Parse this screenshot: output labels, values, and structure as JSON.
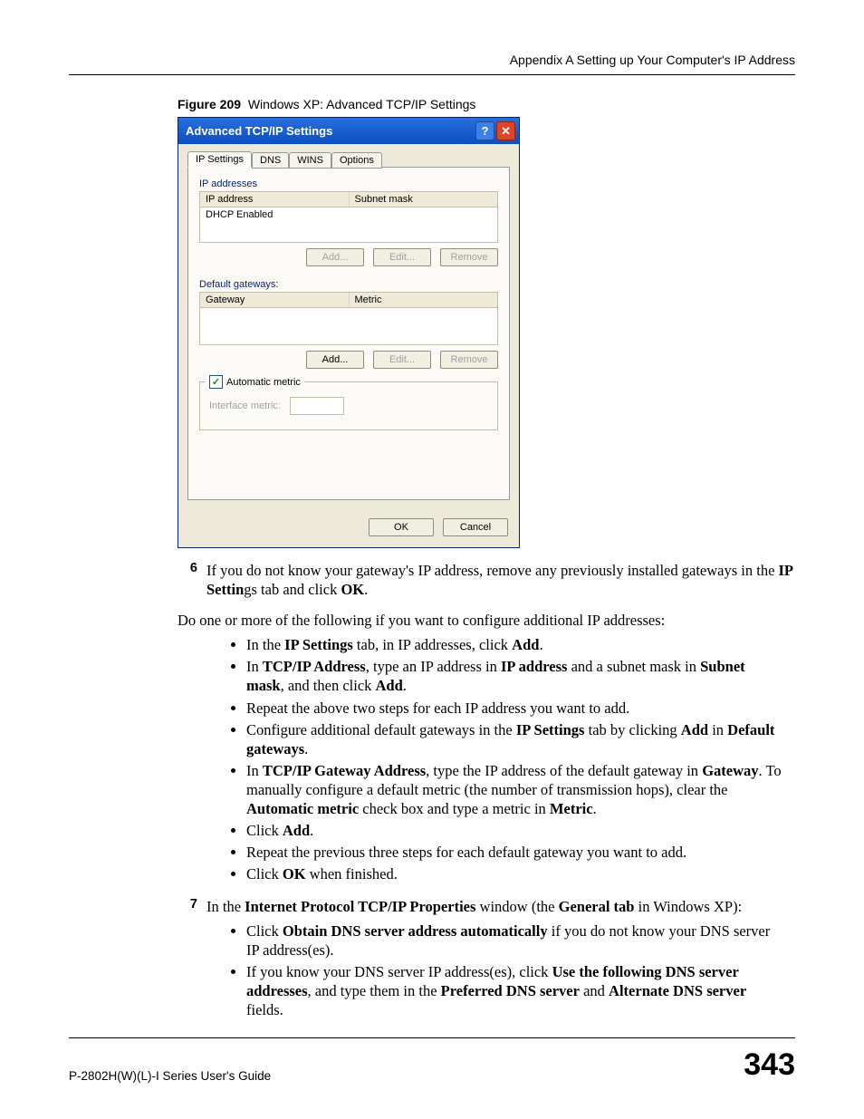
{
  "header": {
    "section": "Appendix A Setting up Your Computer's IP Address"
  },
  "caption": {
    "label": "Figure 209",
    "text": "Windows XP: Advanced TCP/IP Settings"
  },
  "dialog": {
    "title": "Advanced TCP/IP Settings",
    "help_glyph": "?",
    "close_glyph": "✕",
    "tabs": {
      "ip": "IP Settings",
      "dns": "DNS",
      "wins": "WINS",
      "options": "Options"
    },
    "ipaddr": {
      "legend": "IP addresses",
      "col1": "IP address",
      "col2": "Subnet mask",
      "status": "DHCP Enabled"
    },
    "gw": {
      "legend": "Default gateways:",
      "col1": "Gateway",
      "col2": "Metric"
    },
    "metric": {
      "check_label": "Automatic metric",
      "field_label": "Interface metric:"
    },
    "buttons": {
      "add": "Add...",
      "edit": "Edit...",
      "remove": "Remove",
      "ok": "OK",
      "cancel": "Cancel"
    }
  },
  "step6": {
    "num": "6",
    "text_a": "If you do not know your gateway's IP address, remove any previously installed gateways in the ",
    "bold_a": "IP Settin",
    "text_b": "gs tab and click ",
    "bold_b": "OK",
    "text_c": "."
  },
  "para": "Do one or more of the following if you want to configure additional IP addresses:",
  "bullets": {
    "b1": {
      "a": "In the ",
      "b1": "IP Settings",
      "b": " tab, in IP addresses, click ",
      "b2": "Add",
      "c": "."
    },
    "b2": {
      "a": "In ",
      "b1": "TCP/IP Address",
      "b": ", type an IP address in ",
      "b2": "IP address",
      "c": " and a subnet mask in ",
      "b3": "Subnet mask",
      "d": ", and then click ",
      "b4": "Add",
      "e": "."
    },
    "b3": {
      "a": "Repeat the above two steps for each IP address you want to add."
    },
    "b4": {
      "a": "Configure additional default gateways in the ",
      "b1": "IP Settings",
      "b": " tab by clicking ",
      "b2": "Add",
      "c": " in ",
      "b3": "Default gateways",
      "d": "."
    },
    "b5": {
      "a": "In ",
      "b1": "TCP/IP Gateway Address",
      "b": ", type the IP address of the default gateway in ",
      "b2": "Gateway",
      "c": ". To manually configure a default metric (the number of transmission hops), clear the ",
      "b3": "Automatic metric",
      "d": " check box and type a metric in ",
      "b4": "Metric",
      "e": "."
    },
    "b6": {
      "a": "Click ",
      "b1": "Add",
      "b": "."
    },
    "b7": {
      "a": "Repeat the previous three steps for each default gateway you want to add."
    },
    "b8": {
      "a": "Click ",
      "b1": "OK",
      "b": " when finished."
    }
  },
  "step7": {
    "num": "7",
    "a": "In the ",
    "b1": "Internet Protocol TCP/IP Properties",
    "b": " window (the ",
    "b2": "General tab",
    "c": " in Windows XP):"
  },
  "bullets7": {
    "b1": {
      "a": "Click ",
      "b1": "Obtain DNS server address automatically",
      "b": " if you do not know your DNS server IP address(es)."
    },
    "b2": {
      "a": "If you know your DNS server IP address(es), click ",
      "b1": "Use the following DNS server addresses",
      "b": ", and type them in the ",
      "b2": "Preferred DNS server",
      "c": " and ",
      "b3": "Alternate DNS server",
      "d": " fields."
    }
  },
  "footer": {
    "left": "P-2802H(W)(L)-I Series User's Guide",
    "right": "343"
  }
}
